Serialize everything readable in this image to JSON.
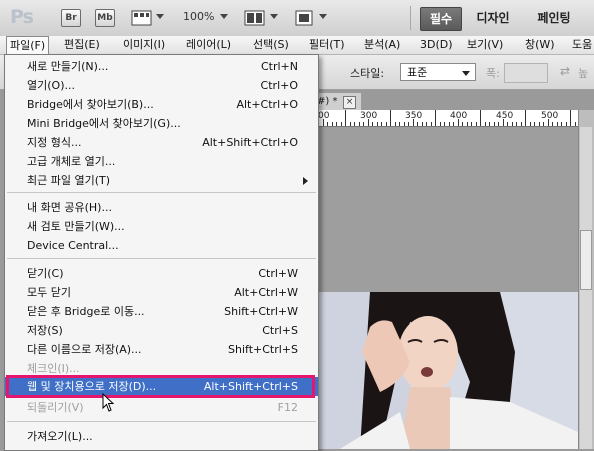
{
  "appbar": {
    "logo": "Ps",
    "br_label": "Br",
    "mb_label": "Mb",
    "zoom": "100%",
    "workspaces": [
      "필수",
      "디자인",
      "페인팅"
    ]
  },
  "menubar": [
    "파일(F)",
    "편집(E)",
    "이미지(I)",
    "레이어(L)",
    "선택(S)",
    "필터(T)",
    "분석(A)",
    "3D(D)",
    "보기(V)",
    "창(W)",
    "도움"
  ],
  "options": {
    "style_label": "스타일:",
    "style_value": "표준",
    "width_label": "폭:",
    "swap_icon": "⇄",
    "height_label": "높"
  },
  "document": {
    "tab_title": "#) *",
    "close_label": "×",
    "ruler_labels": [
      "00",
      "300",
      "350",
      "400",
      "450",
      "500"
    ]
  },
  "filemenu": {
    "items": [
      {
        "label": "새로 만들기(N)...",
        "shortcut": "Ctrl+N"
      },
      {
        "label": "열기(O)...",
        "shortcut": "Ctrl+O"
      },
      {
        "label": "Bridge에서 찾아보기(B)...",
        "shortcut": "Alt+Ctrl+O"
      },
      {
        "label": "Mini Bridge에서 찾아보기(G)...",
        "shortcut": ""
      },
      {
        "label": "지정 형식...",
        "shortcut": "Alt+Shift+Ctrl+O"
      },
      {
        "label": "고급 개체로 열기...",
        "shortcut": ""
      },
      {
        "label": "최근 파일 열기(T)",
        "shortcut": ""
      },
      {
        "label": "내 화면 공유(H)...",
        "shortcut": ""
      },
      {
        "label": "새 검토 만들기(W)...",
        "shortcut": ""
      },
      {
        "label": "Device Central...",
        "shortcut": ""
      },
      {
        "label": "닫기(C)",
        "shortcut": "Ctrl+W"
      },
      {
        "label": "모두 닫기",
        "shortcut": "Alt+Ctrl+W"
      },
      {
        "label": "닫은 후 Bridge로 이동...",
        "shortcut": "Shift+Ctrl+W"
      },
      {
        "label": "저장(S)",
        "shortcut": "Ctrl+S"
      },
      {
        "label": "다른 이름으로 저장(A)...",
        "shortcut": "Shift+Ctrl+S"
      },
      {
        "label": "체크인(I)...",
        "shortcut": ""
      },
      {
        "label": "웹 및 장치용으로 저장(D)...",
        "shortcut": "Alt+Shift+Ctrl+S"
      },
      {
        "label": "되돌리기(V)",
        "shortcut": "F12"
      },
      {
        "label": "가져오기(L)...",
        "shortcut": ""
      }
    ]
  },
  "colors": {
    "highlight_bg": "#3f6fc7",
    "highlight_frame": "#e6166e",
    "menu_bg": "#f5f5f5"
  }
}
